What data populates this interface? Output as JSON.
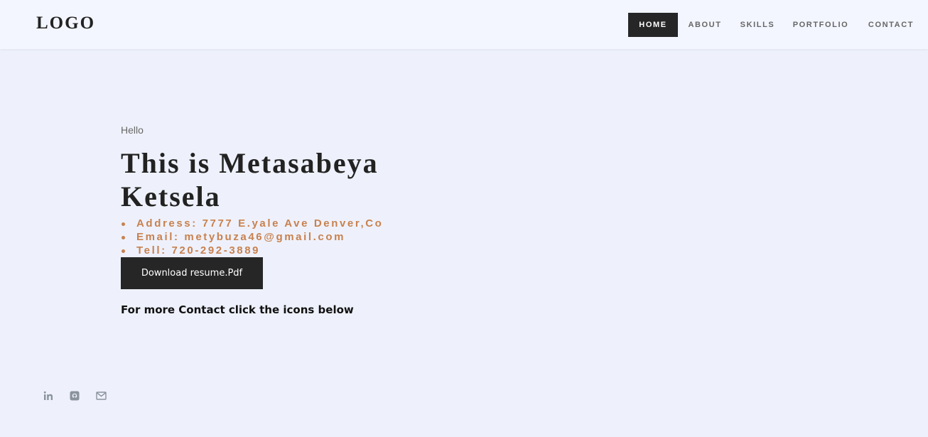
{
  "header": {
    "logo": "LOGO",
    "nav": [
      {
        "label": "HOME",
        "active": true
      },
      {
        "label": "ABOUT",
        "active": false
      },
      {
        "label": "SKILLS",
        "active": false
      },
      {
        "label": "PORTFOLIO",
        "active": false
      },
      {
        "label": "CONTACT",
        "active": false
      }
    ]
  },
  "hero": {
    "greeting": "Hello",
    "name_line1": "This is Metasabeya",
    "name_line2": "Ketsela",
    "contact": [
      "Address: 7777 E.yale Ave Denver,Co",
      "Email: metybuza46@gmail.com",
      "Tell: 720-292-3889"
    ],
    "download_label": "Download resume.Pdf",
    "more_text": "For more Contact click the icons below"
  },
  "social": [
    {
      "icon": "linkedin-icon"
    },
    {
      "icon": "github-icon"
    },
    {
      "icon": "mail-icon"
    }
  ],
  "colors": {
    "background": "#eef1fb",
    "header_bg": "#f3f6fe",
    "accent": "#c8814f",
    "dark": "#262626"
  }
}
